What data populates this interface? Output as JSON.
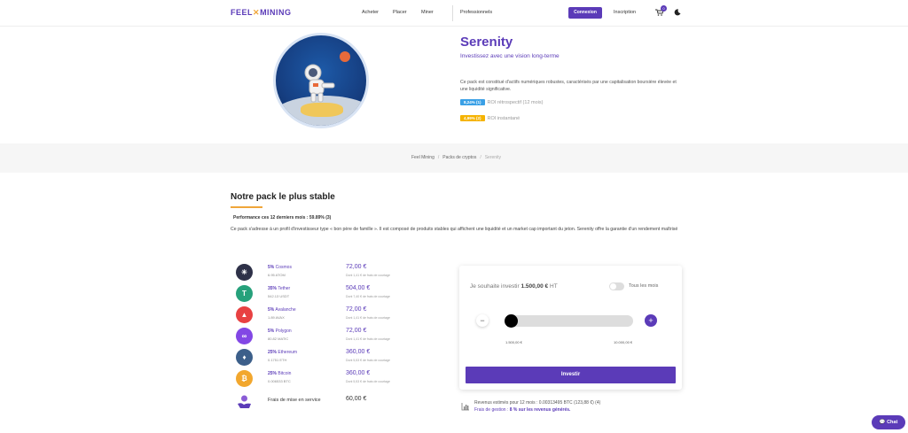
{
  "nav": {
    "logo_left": "FEEL",
    "logo_x": "✕",
    "logo_right": "MINING",
    "links": [
      "Acheter",
      "Placer",
      "Miner",
      "Professionnels"
    ],
    "connexion": "Connexion",
    "inscription": "Inscription",
    "cart_count": "0"
  },
  "hero": {
    "title": "Serenity",
    "subtitle": "Investissez avec une vision long-terme",
    "description": "Ce pack est constitué d'actifs numériques robustes, caractérisés par une capitalisation boursière élevée et une liquidité significative.",
    "roi1_badge": "8,24% (1)",
    "roi1_label": "ROI rétrospectif (12 mois)",
    "roi2_badge": "4,99% (2)",
    "roi2_label": "ROI instantané",
    "colors": {
      "roi1": "#3aa0e6",
      "roi2": "#f5b301"
    }
  },
  "breadcrumb": {
    "home": "Feel Mining",
    "packs": "Packs de cryptos",
    "current": "Serenity"
  },
  "section": {
    "title": "Notre pack le plus stable",
    "performance": "Performance ces 12 derniers mois : 59.89% (3)",
    "description": "Ce pack s'adresse à un profil d'investisseur type « bon père de famille ». Il est composé de produits stables qui affichent une liquidité et un market cap important du jeton. Serenity offre la garantie d'un rendement maîtrisé"
  },
  "assets": [
    {
      "pct": "5%",
      "name": "Cosmos",
      "qty": "6.95 ATOM",
      "value": "72,00 €",
      "fee": "Dont 1,41 € de frais de courtage",
      "icon": "cosmos-icon",
      "color": "#2e3148",
      "glyph": "✳"
    },
    {
      "pct": "35%",
      "name": "Tether",
      "qty": "542.13 USDT",
      "value": "504,00 €",
      "fee": "Dont 7,40 € de frais de courtage",
      "icon": "tether-icon",
      "color": "#26a17b",
      "glyph": "T"
    },
    {
      "pct": "5%",
      "name": "Avalanche",
      "qty": "1.89 AVAX",
      "value": "72,00 €",
      "fee": "Dont 1,41 € de frais de courtage",
      "icon": "avalanche-icon",
      "color": "#e84142",
      "glyph": "▲"
    },
    {
      "pct": "5%",
      "name": "Polygon",
      "qty": "80.82 MATIC",
      "value": "72,00 €",
      "fee": "Dont 1,41 € de frais de courtage",
      "icon": "polygon-icon",
      "color": "#8247e5",
      "glyph": "∞"
    },
    {
      "pct": "25%",
      "name": "Ethereum",
      "qty": "0.1751 ETH",
      "value": "360,00 €",
      "fee": "Dont 5,53 € de frais de courtage",
      "icon": "ethereum-icon",
      "color": "#3c5f8a",
      "glyph": "♦"
    },
    {
      "pct": "25%",
      "name": "Bitcoin",
      "qty": "0.006533 BTC",
      "value": "360,00 €",
      "fee": "Dont 5,53 € de frais de courtage",
      "icon": "bitcoin-icon",
      "color": "#f2a72e",
      "glyph": "₿"
    }
  ],
  "frais": {
    "label": "Frais de mise en service",
    "value": "60,00 €"
  },
  "card": {
    "label_prefix": "Je souhaite investir",
    "amount": "1.500,00 €",
    "label_suffix": "HT",
    "toggle_label": "Tous les mois",
    "slider_min": "1.500,00 €",
    "slider_max": "10.000,00 €",
    "slider_level": 0,
    "invest": "Investir"
  },
  "revenue": {
    "line1": "Revenus estimés pour 12 mois : 0.00313495 BTC (123,88 €) (4)",
    "line2_prefix": "Frais de gestion :",
    "line2_bold": "8 % sur les revenus générés."
  },
  "chat": "Chat"
}
